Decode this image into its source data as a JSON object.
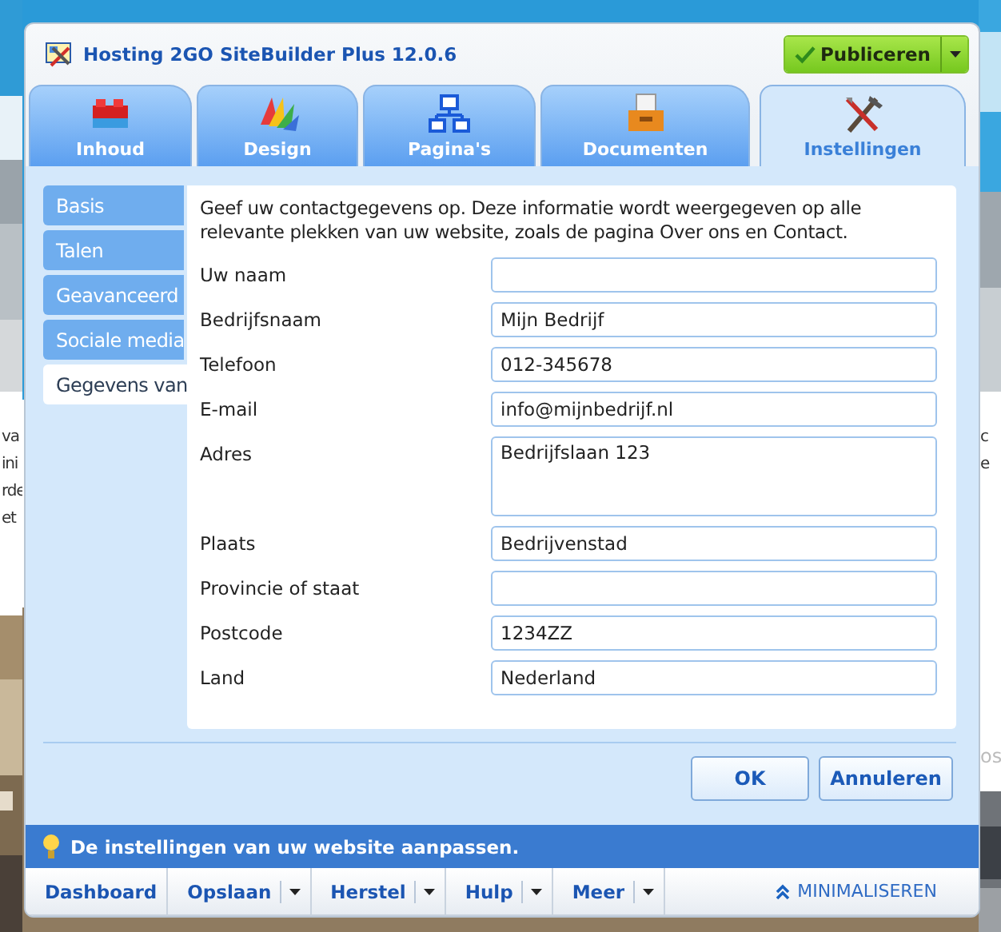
{
  "backdrop": {
    "left_texts": [
      "va",
      "ini",
      "rde",
      "et"
    ],
    "right_texts": [
      "c",
      "e"
    ],
    "right_lower_text": "os"
  },
  "window": {
    "title": "Hosting 2GO SiteBuilder Plus 12.0.6"
  },
  "publish_button": {
    "label": "Publiceren"
  },
  "tabs": [
    {
      "label": "Inhoud",
      "selected": false
    },
    {
      "label": "Design",
      "selected": false
    },
    {
      "label": "Pagina's",
      "selected": false
    },
    {
      "label": "Documenten",
      "selected": false
    },
    {
      "label": "Instellingen",
      "selected": true
    }
  ],
  "sidebar": {
    "items": [
      {
        "label": "Basis",
        "selected": false
      },
      {
        "label": "Talen",
        "selected": false
      },
      {
        "label": "Geavanceerd",
        "selected": false
      },
      {
        "label": "Sociale media",
        "selected": false
      },
      {
        "label": "Gegevens van",
        "selected": true
      }
    ]
  },
  "intro": "Geef uw contactgegevens op. Deze informatie wordt weergegeven op alle relevante plekken van uw website, zoals de pagina Over ons en Contact.",
  "fields": [
    {
      "label": "Uw naam",
      "kind": "input"
    },
    {
      "label": "Bedrijfsnaam",
      "kind": "input",
      "value": "Mijn Bedrijf"
    },
    {
      "label": "Telefoon",
      "kind": "input",
      "value": "012-345678"
    },
    {
      "label": "E-mail",
      "kind": "input",
      "value": "info@mijnbedrijf.nl"
    },
    {
      "label": "Adres",
      "kind": "textarea",
      "value": "Bedrijfslaan 123"
    },
    {
      "label": "Plaats",
      "kind": "input",
      "value": "Bedrijvenstad"
    },
    {
      "label": "Provincie of staat",
      "kind": "input"
    },
    {
      "label": "Postcode",
      "kind": "input",
      "value": "1234ZZ"
    },
    {
      "label": "Land",
      "kind": "input",
      "value": "Nederland"
    }
  ],
  "buttons": [
    "OK",
    "Annuleren"
  ],
  "status_bar": {
    "text": "De instellingen van uw website aanpassen."
  },
  "toolbar": {
    "items": [
      {
        "label": "Dashboard",
        "has_menu": false
      },
      {
        "label": "Opslaan",
        "has_menu": true
      },
      {
        "label": "Herstel",
        "has_menu": true
      },
      {
        "label": "Hulp",
        "has_menu": true
      },
      {
        "label": "Meer",
        "has_menu": true
      }
    ],
    "minimize": "MINIMALISEREN"
  }
}
